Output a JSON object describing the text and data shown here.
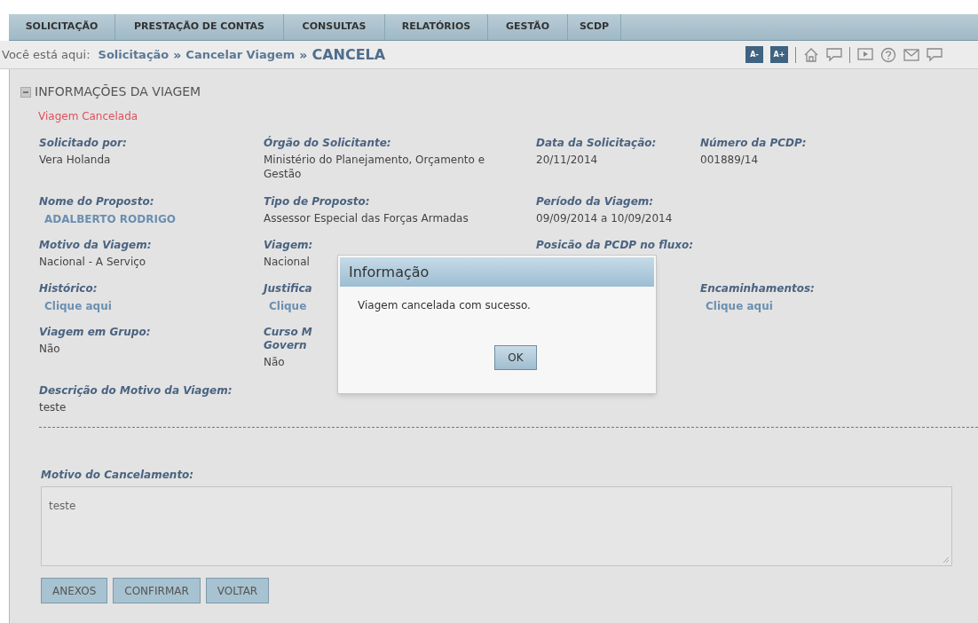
{
  "menu": [
    {
      "label": "SOLICITAÇÃO"
    },
    {
      "label": "PRESTAÇÃO DE CONTAS"
    },
    {
      "label": "CONSULTAS"
    },
    {
      "label": "RELATÓRIOS"
    },
    {
      "label": "GESTÃO"
    },
    {
      "label": "SCDP"
    }
  ],
  "breadcrumb": {
    "prefix": "Você está aqui:",
    "separator": "»",
    "items": [
      "Solicitação",
      "Cancelar Viagem",
      "CANCELA"
    ]
  },
  "toolbar": {
    "font_buttons": [
      "A-",
      "A+"
    ],
    "icons": [
      {
        "kind": "separator"
      },
      {
        "kind": "home"
      },
      {
        "kind": "chat"
      },
      {
        "kind": "separator"
      },
      {
        "kind": "video"
      },
      {
        "kind": "help"
      },
      {
        "kind": "mail"
      },
      {
        "kind": "partial"
      }
    ]
  },
  "section": {
    "title": "INFORMAÇÕES DA VIAGEM",
    "expanded": true,
    "status": "Viagem Cancelada"
  },
  "rows": [
    {
      "cells": [
        {
          "kind": "text",
          "label": "Solicitado por:",
          "value": "Vera Holanda"
        },
        {
          "kind": "text",
          "label": "Órgão do Solicitante:",
          "value": "Ministério do Planejamento, Orçamento e Gestão"
        },
        {
          "kind": "text",
          "label": "Data da Solicitação:",
          "value": "20/11/2014"
        },
        {
          "kind": "text",
          "label": "Número da PCDP:",
          "value": "001889/14"
        }
      ]
    },
    {
      "cells": [
        {
          "kind": "link",
          "label": "Nome do Proposto:",
          "value": "ADALBERTO RODRIGO"
        },
        {
          "kind": "text",
          "label": "Tipo de Proposto:",
          "value": "Assessor Especial das Forças Armadas"
        },
        {
          "kind": "text",
          "label": "Período da Viagem:",
          "value": "09/09/2014 a 10/09/2014"
        },
        {
          "kind": "empty"
        }
      ]
    },
    {
      "cells": [
        {
          "kind": "text",
          "label": "Motivo da Viagem:",
          "value": "Nacional - A Serviço"
        },
        {
          "kind": "text",
          "label": "Viagem:",
          "value": "Nacional"
        },
        {
          "kind": "label",
          "label": "Posicão da PCDP no fluxo:"
        },
        {
          "kind": "empty"
        }
      ]
    },
    {
      "cells": [
        {
          "kind": "link",
          "label": "Histórico:",
          "value": "Clique aqui"
        },
        {
          "kind": "link",
          "label": "Justifica",
          "value": "Clique"
        },
        {
          "kind": "empty"
        },
        {
          "kind": "link",
          "label": "Encaminhamentos:",
          "value": "Clique aqui"
        }
      ]
    },
    {
      "cells": [
        {
          "kind": "text",
          "label": "Viagem em Grupo:",
          "value": "Não"
        },
        {
          "kind": "text",
          "label": [
            "Curso M",
            "Govern"
          ],
          "value": "Não"
        },
        {
          "kind": "empty"
        },
        {
          "kind": "empty"
        }
      ]
    },
    {
      "cells": [
        {
          "kind": "text",
          "label": "Descrição do Motivo da Viagem:",
          "value": "teste"
        }
      ]
    }
  ],
  "cancel": {
    "label": "Motivo do Cancelamento:",
    "value": "teste"
  },
  "buttons": [
    "ANEXOS",
    "CONFIRMAR",
    "VOLTAR"
  ],
  "dialog": {
    "title": "Informação",
    "message": "Viagem cancelada com sucesso.",
    "button": "OK"
  }
}
